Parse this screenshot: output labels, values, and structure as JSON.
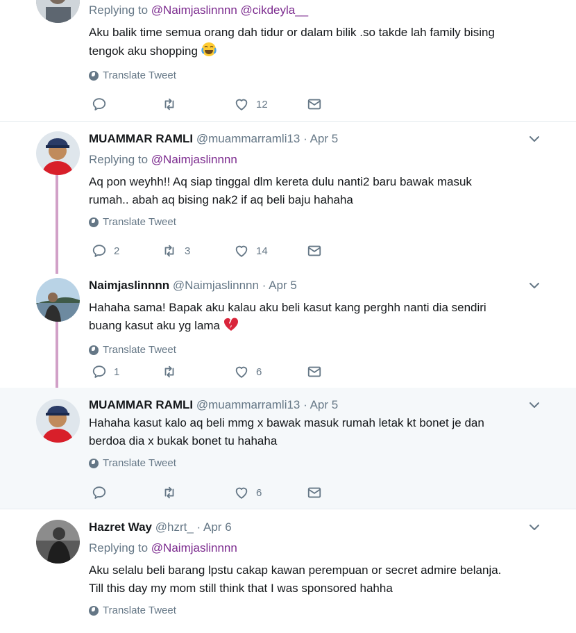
{
  "translate_label": "Translate Tweet",
  "tweets": [
    {
      "name": "",
      "handle": "",
      "date": "",
      "replying_prefix": "Replying to",
      "replying_to": "@Naimjaslinnnn @cikdeyla__",
      "text_line1": "Aku balik time semua orang dah tidur or dalam bilik .so takde lah family bising",
      "text_line2": "tengok aku shopping",
      "emoji": "face-with-tears-of-joy",
      "replies": "",
      "retweets": "",
      "likes": "12"
    },
    {
      "name": "MUAMMAR RAMLI",
      "handle": "@muammarramli13",
      "dot": "·",
      "date": "Apr 5",
      "replying_prefix": "Replying to",
      "replying_to": "@Naimjaslinnnn",
      "text_line1": "Aq pon weyhh!! Aq siap tinggal dlm kereta dulu nanti2 baru bawak masuk",
      "text_line2": "rumah.. abah aq bising nak2 if aq beli baju hahaha",
      "replies": "2",
      "retweets": "3",
      "likes": "14"
    },
    {
      "name": "Naimjaslinnnn",
      "handle": "@Naimjaslinnnn",
      "dot": "·",
      "date": "Apr 5",
      "text_line1": "Hahaha sama! Bapak aku kalau aku beli kasut kang perghh nanti dia sendiri",
      "text_line2": "buang kasut aku yg lama",
      "emoji": "broken-heart",
      "replies": "1",
      "retweets": "",
      "likes": "6"
    },
    {
      "name": "MUAMMAR RAMLI",
      "handle": "@muammarramli13",
      "dot": "·",
      "date": "Apr 5",
      "text_line1": "Hahaha kasut kalo aq beli mmg x bawak masuk rumah letak kt bonet je dan",
      "text_line2": "berdoa dia x bukak bonet tu hahaha",
      "replies": "",
      "retweets": "",
      "likes": "6"
    },
    {
      "name": "Hazret Way",
      "handle": "@hzrt_",
      "dot": "·",
      "date": "Apr 6",
      "replying_prefix": "Replying to",
      "replying_to": "@Naimjaslinnnn",
      "text_line1": "Aku selalu beli barang lpstu cakap kawan perempuan or secret admire belanja.",
      "text_line2": "Till this day my mom still think that I was sponsored hahha"
    }
  ],
  "colors": {
    "mention": "#7b2a8e",
    "thread_line": "#d1a0c7",
    "muted": "#657786",
    "highlight_bg": "#f5f8fa"
  }
}
